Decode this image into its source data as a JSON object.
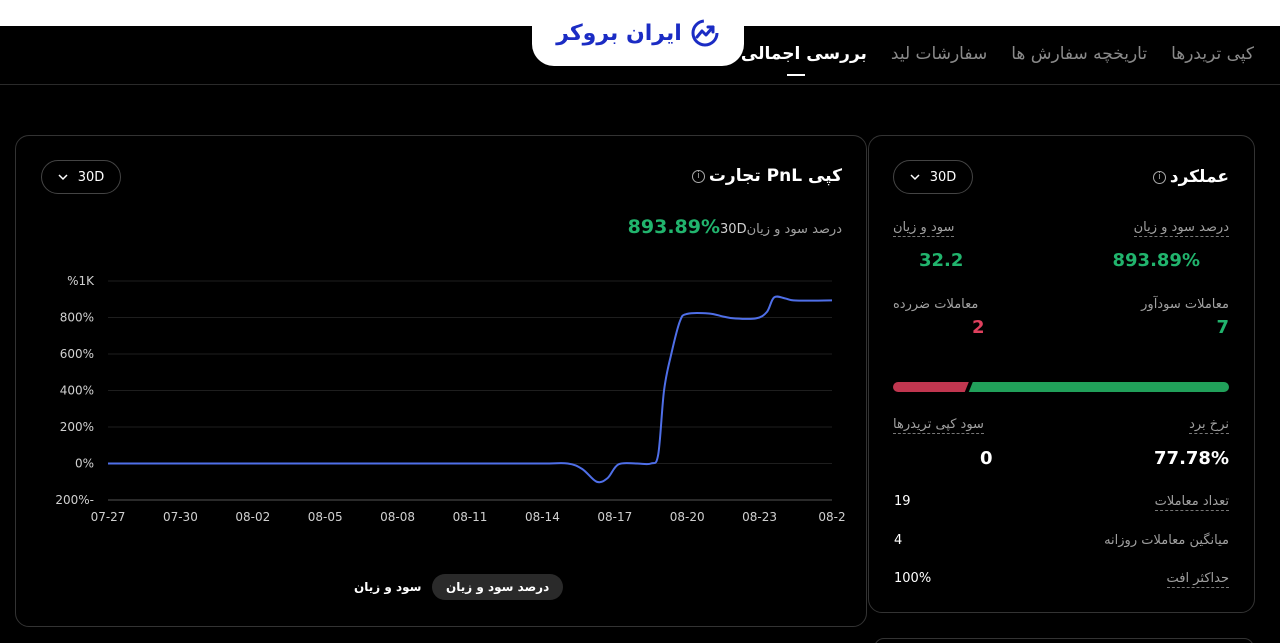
{
  "brand": {
    "name": "ایران بروکر",
    "color": "#1b2cc4"
  },
  "tabs": [
    {
      "label": "بررسی اجمالی",
      "active": true
    },
    {
      "label": "سفارشات لید",
      "active": false
    },
    {
      "label": "تاریخچه سفارش ها",
      "active": false
    },
    {
      "label": "کپی تریدرها",
      "active": false
    }
  ],
  "pnl_card": {
    "title": "کپی PnL تجارت",
    "info_icon": "info-icon",
    "period": "30D",
    "subtitle_label": "درصد سود و زیان",
    "subtitle_period": "30D",
    "subtitle_value": "893.89%",
    "toggle_percent": "درصد سود و زیان",
    "toggle_value": "سود و زیان"
  },
  "chart_data": {
    "type": "line",
    "x": [
      "07-27",
      "07-30",
      "08-02",
      "08-05",
      "08-08",
      "08-11",
      "08-14",
      "08-17",
      "08-20",
      "08-23",
      "08-2"
    ],
    "y_ticks": [
      "%1K",
      "800%",
      "600%",
      "400%",
      "200%",
      "0%",
      "200%-"
    ],
    "ylim": [
      -200,
      1000
    ],
    "line_color": "#4f6fe8",
    "series": [
      {
        "values": [
          [
            0,
            0
          ],
          [
            1,
            0
          ],
          [
            2,
            0
          ],
          [
            3,
            0
          ],
          [
            4,
            0
          ],
          [
            5,
            0
          ],
          [
            6,
            0
          ],
          [
            6.35,
            0
          ],
          [
            6.55,
            -30
          ],
          [
            6.75,
            -100
          ],
          [
            6.9,
            -80
          ],
          [
            7.05,
            -5
          ],
          [
            7.3,
            0
          ],
          [
            7.5,
            0
          ],
          [
            7.6,
            50
          ],
          [
            7.68,
            400
          ],
          [
            7.78,
            600
          ],
          [
            7.9,
            780
          ],
          [
            8.0,
            820
          ],
          [
            8.3,
            822
          ],
          [
            8.5,
            805
          ],
          [
            8.65,
            795
          ],
          [
            8.95,
            795
          ],
          [
            9.1,
            830
          ],
          [
            9.2,
            910
          ],
          [
            9.35,
            905
          ],
          [
            9.5,
            893
          ],
          [
            10,
            893.89
          ]
        ]
      }
    ]
  },
  "performance": {
    "title": "عملکرد",
    "period": "30D",
    "pnl_pct_label": "درصد سود و زیان",
    "pnl_pct_value": "893.89%",
    "pnl_label": "سود و زیان",
    "pnl_value": "32.2",
    "win_trades_label": "معاملات سودآور",
    "win_trades_value": "7",
    "loss_trades_label": "معاملات ضررده",
    "loss_trades_value": "2",
    "win_color": "#21a05a",
    "loss_color": "#c0364f",
    "win_rate_label": "نرخ برد",
    "win_rate_value": "77.78%",
    "copy_profit_label": "سود کپی تریدرها",
    "copy_profit_value": "0",
    "total_trades_label": "تعداد معاملات",
    "total_trades_value": "19",
    "avg_daily_label": "میانگین معاملات روزانه",
    "avg_daily_value": "4",
    "max_drawdown_label": "حداکثر افت",
    "max_drawdown_value": "100%"
  }
}
